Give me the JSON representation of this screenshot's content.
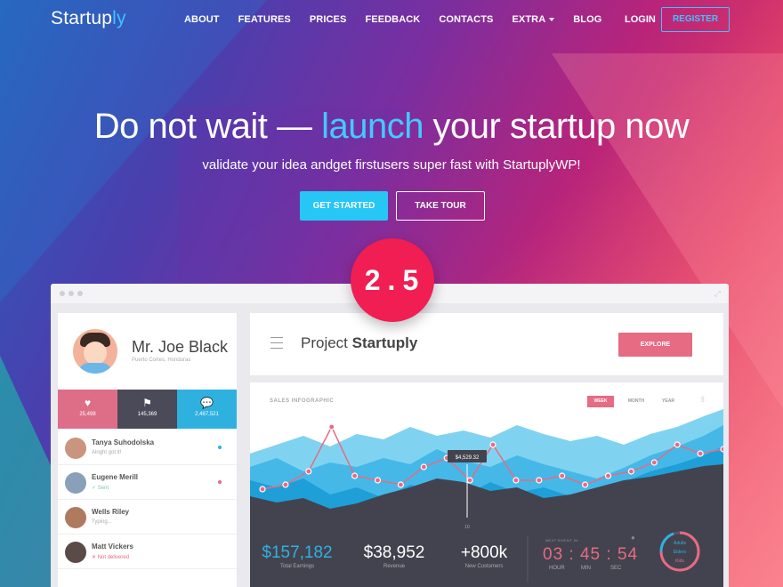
{
  "nav": {
    "logo_main": "Startup",
    "logo_accent": "ly",
    "items": [
      "ABOUT",
      "FEATURES",
      "PRICES",
      "FEEDBACK",
      "CONTACTS",
      "EXTRA",
      "BLOG"
    ],
    "login": "LOGIN",
    "register": "REGISTER"
  },
  "hero": {
    "title_pre": "Do not wait — ",
    "title_accent": "launch",
    "title_post": " your startup now",
    "subtitle": "validate your idea andget firstusers super fast with StartuplyWP!",
    "btn_start": "GET STARTED",
    "btn_tour": "TAKE TOUR"
  },
  "badge": "2.5",
  "profile": {
    "name": "Mr. Joe Black",
    "location": "Puerto Cortes, Honduras",
    "stats": [
      {
        "icon": "heart-icon",
        "value": "25,498"
      },
      {
        "icon": "flag-icon",
        "value": "145,369"
      },
      {
        "icon": "chat-icon",
        "value": "2,487,521"
      }
    ],
    "contacts": [
      {
        "name": "Tanya Suhodolska",
        "status": "Alright got it!",
        "dot": "#2fb1e0"
      },
      {
        "name": "Eugene Merill",
        "status": "✓ Sent",
        "dot": "#e76b83"
      },
      {
        "name": "Wells Riley",
        "status": "Typing...",
        "dot": ""
      },
      {
        "name": "Matt Vickers",
        "status": "✕ Not delivered",
        "dot": ""
      }
    ]
  },
  "project": {
    "title_pre": "Project ",
    "title_bold": "Startuply",
    "explore": "EXPLORE"
  },
  "sales": {
    "label": "SALES INFOGRAPHIC",
    "tabs": [
      "WEEK",
      "MONTH",
      "YEAR"
    ],
    "tooltip": "$4,529.32",
    "axis_tick": "10",
    "kpis": [
      {
        "value": "$157,182",
        "label": "Total Earnings"
      },
      {
        "value": "$38,952",
        "label": "Revenue"
      },
      {
        "value": "+800k",
        "label": "New Customers"
      }
    ],
    "next_event": "NEXT EVENT IN",
    "timer": {
      "h": "03",
      "m": "45",
      "s": "54",
      "h_lbl": "HOUR",
      "m_lbl": "MIN",
      "s_lbl": "SEC"
    },
    "donut_labels": [
      "Adults",
      "Elders",
      "Kids"
    ]
  },
  "colors": {
    "accent_blue": "#26c6f5",
    "accent_pink": "#e76b83",
    "badge_red": "#f01e52",
    "chart_dark": "#43434f"
  },
  "chart_data": {
    "type": "line",
    "series": [
      {
        "values": [
          8,
          9,
          12,
          22,
          11,
          10,
          9,
          13,
          15,
          10,
          18,
          10,
          10,
          11,
          9,
          11,
          12,
          14,
          18,
          16,
          17
        ]
      }
    ]
  }
}
